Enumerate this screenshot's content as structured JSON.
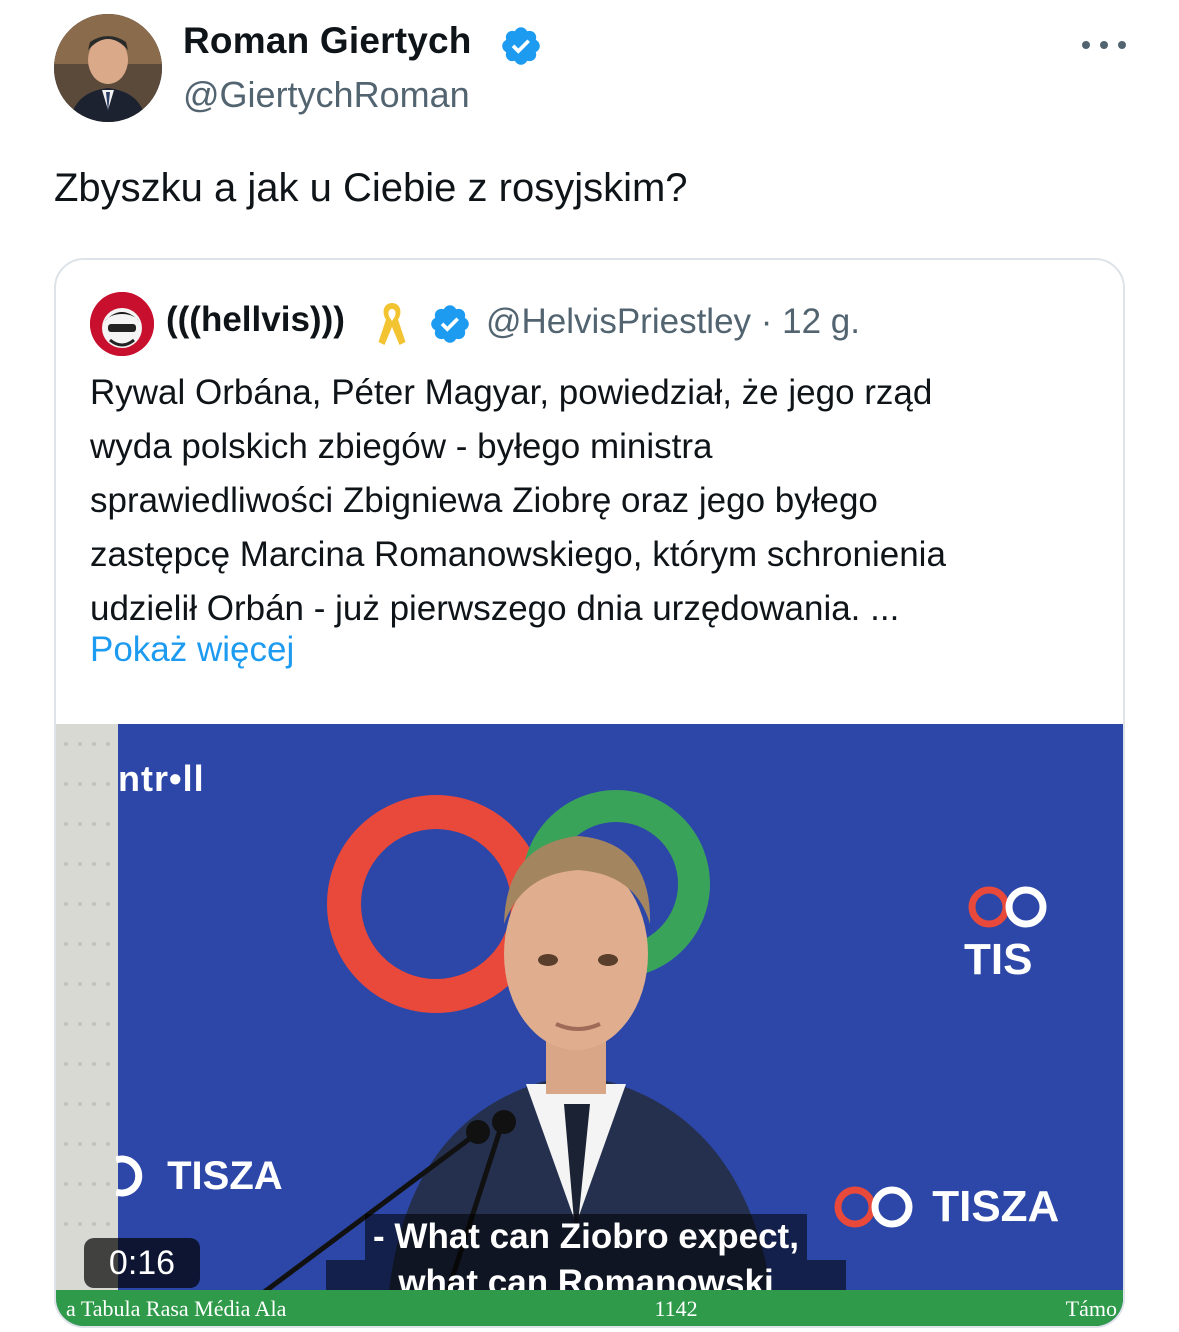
{
  "tweet": {
    "author_name": "Roman Giertych",
    "author_handle": "@GiertychRoman",
    "text": "Zbyszku a jak u Ciebie z rosyjskim?"
  },
  "quoted": {
    "author_name": "(((hellvis)))",
    "author_handle": "@HelvisPriestley · 12 g.",
    "body_lines": [
      "Rywal Orbána, Péter Magyar, powiedział, że jego rząd",
      "wyda polskich zbiegów - byłego ministra",
      "sprawiedliwości Zbigniewa Ziobrę oraz jego byłego",
      "zastępcę Marcina Romanowskiego, którym schronienia",
      "udzielił Orbán - już pierwszego dnia urzędowania. ..."
    ],
    "show_more": "Pokaż więcej"
  },
  "video": {
    "broadcaster": "ntr•ll",
    "logo_text_top": "TIS",
    "logo_text_left": "TISZA",
    "logo_text_right": "TISZA",
    "subtitle_line1": "- What can Ziobro expect,",
    "subtitle_line2": "what can Romanowski expect?",
    "timestamp": "0:16",
    "ticker_left": "a Tabula Rasa Média Ala",
    "ticker_middle": "1142",
    "ticker_right": "Támo"
  },
  "colors": {
    "verified": "#1d9bf0",
    "link": "#1d9bf0",
    "secondary_text": "#536471",
    "video_bg": "#2d47a8",
    "logo_red": "#e8493a",
    "logo_green": "#3aa35a"
  }
}
